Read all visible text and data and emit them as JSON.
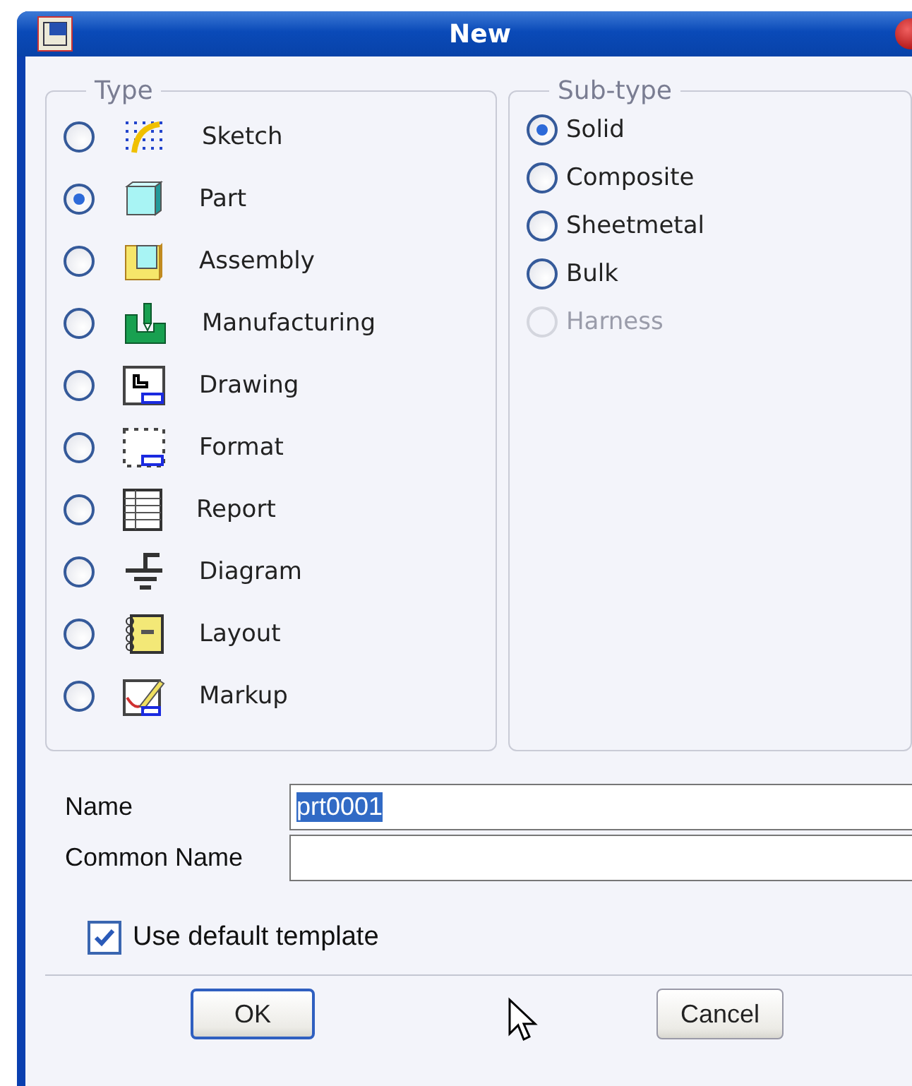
{
  "window": {
    "title": "New"
  },
  "type_group": {
    "legend": "Type",
    "options": [
      {
        "label": "Sketch",
        "selected": false
      },
      {
        "label": "Part",
        "selected": true
      },
      {
        "label": "Assembly",
        "selected": false
      },
      {
        "label": "Manufacturing",
        "selected": false
      },
      {
        "label": "Drawing",
        "selected": false
      },
      {
        "label": "Format",
        "selected": false
      },
      {
        "label": "Report",
        "selected": false
      },
      {
        "label": "Diagram",
        "selected": false
      },
      {
        "label": "Layout",
        "selected": false
      },
      {
        "label": "Markup",
        "selected": false
      }
    ]
  },
  "subtype_group": {
    "legend": "Sub-type",
    "options": [
      {
        "label": "Solid",
        "selected": true,
        "disabled": false
      },
      {
        "label": "Composite",
        "selected": false,
        "disabled": false
      },
      {
        "label": "Sheetmetal",
        "selected": false,
        "disabled": false
      },
      {
        "label": "Bulk",
        "selected": false,
        "disabled": false
      },
      {
        "label": "Harness",
        "selected": false,
        "disabled": true
      }
    ]
  },
  "fields": [
    {
      "label": "Name",
      "value": "prt0001",
      "highlighted": true
    },
    {
      "label": "Common Name"
    }
  ],
  "use_default_template": {
    "label": "Use default template",
    "checked": true
  },
  "buttons": [
    {
      "label": "OK",
      "default": true
    },
    {
      "label": "Cancel",
      "default": false
    }
  ]
}
